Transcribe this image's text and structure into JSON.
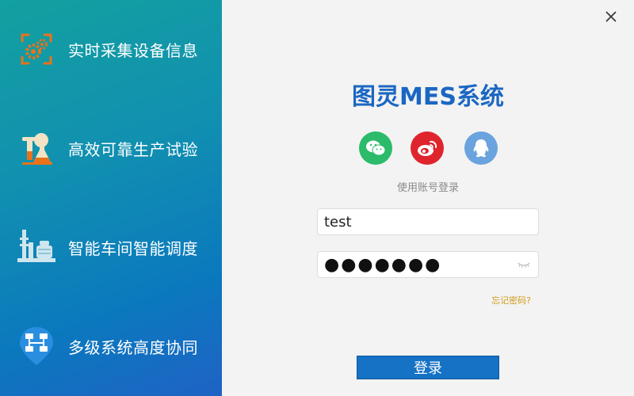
{
  "sidebar": {
    "items": [
      {
        "label": "实时采集设备信息",
        "icon": "gears-icon"
      },
      {
        "label": "高效可靠生产试验",
        "icon": "lab-flask-icon"
      },
      {
        "label": "智能车间智能调度",
        "icon": "factory-icon"
      },
      {
        "label": "多级系统高度协同",
        "icon": "network-pin-icon"
      }
    ]
  },
  "window": {
    "close_icon": "close-icon"
  },
  "login": {
    "title": "图灵MES系统",
    "social": [
      {
        "name": "wechat",
        "icon": "wechat-icon",
        "color": "#2bbb6a"
      },
      {
        "name": "weibo",
        "icon": "weibo-icon",
        "color": "#e0242d"
      },
      {
        "name": "qq",
        "icon": "qq-icon",
        "color": "#6aa3de"
      }
    ],
    "hint": "使用账号登录",
    "username_value": "test",
    "password_value": "●●●●●●●",
    "forgot_label": "忘记密码?",
    "submit_label": "登录"
  },
  "colors": {
    "accent": "#1a67c2",
    "button": "#1572c4",
    "forgot": "#d39a1a"
  }
}
